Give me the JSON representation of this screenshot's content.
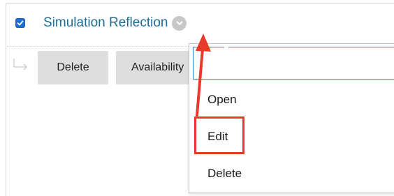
{
  "item": {
    "title": "Simulation Reflection",
    "checkbox_checked": true
  },
  "actions": {
    "delete_label": "Delete",
    "availability_label": "Availability"
  },
  "context_menu": {
    "search_value": "",
    "items": [
      {
        "label": "Open"
      },
      {
        "label": "Edit"
      },
      {
        "label": "Delete"
      }
    ]
  },
  "colors": {
    "title": "#1e6d96",
    "checkbox": "#1f6fd0",
    "focus_border": "#2f7fd1",
    "annotation_red": "#e8392d",
    "button_bg": "#dedede"
  },
  "icons": {
    "checkbox": "checkmark-icon",
    "chevron": "chevron-down-icon",
    "branch": "branch-arrow-icon",
    "annotation": "annotation-arrow-icon"
  }
}
